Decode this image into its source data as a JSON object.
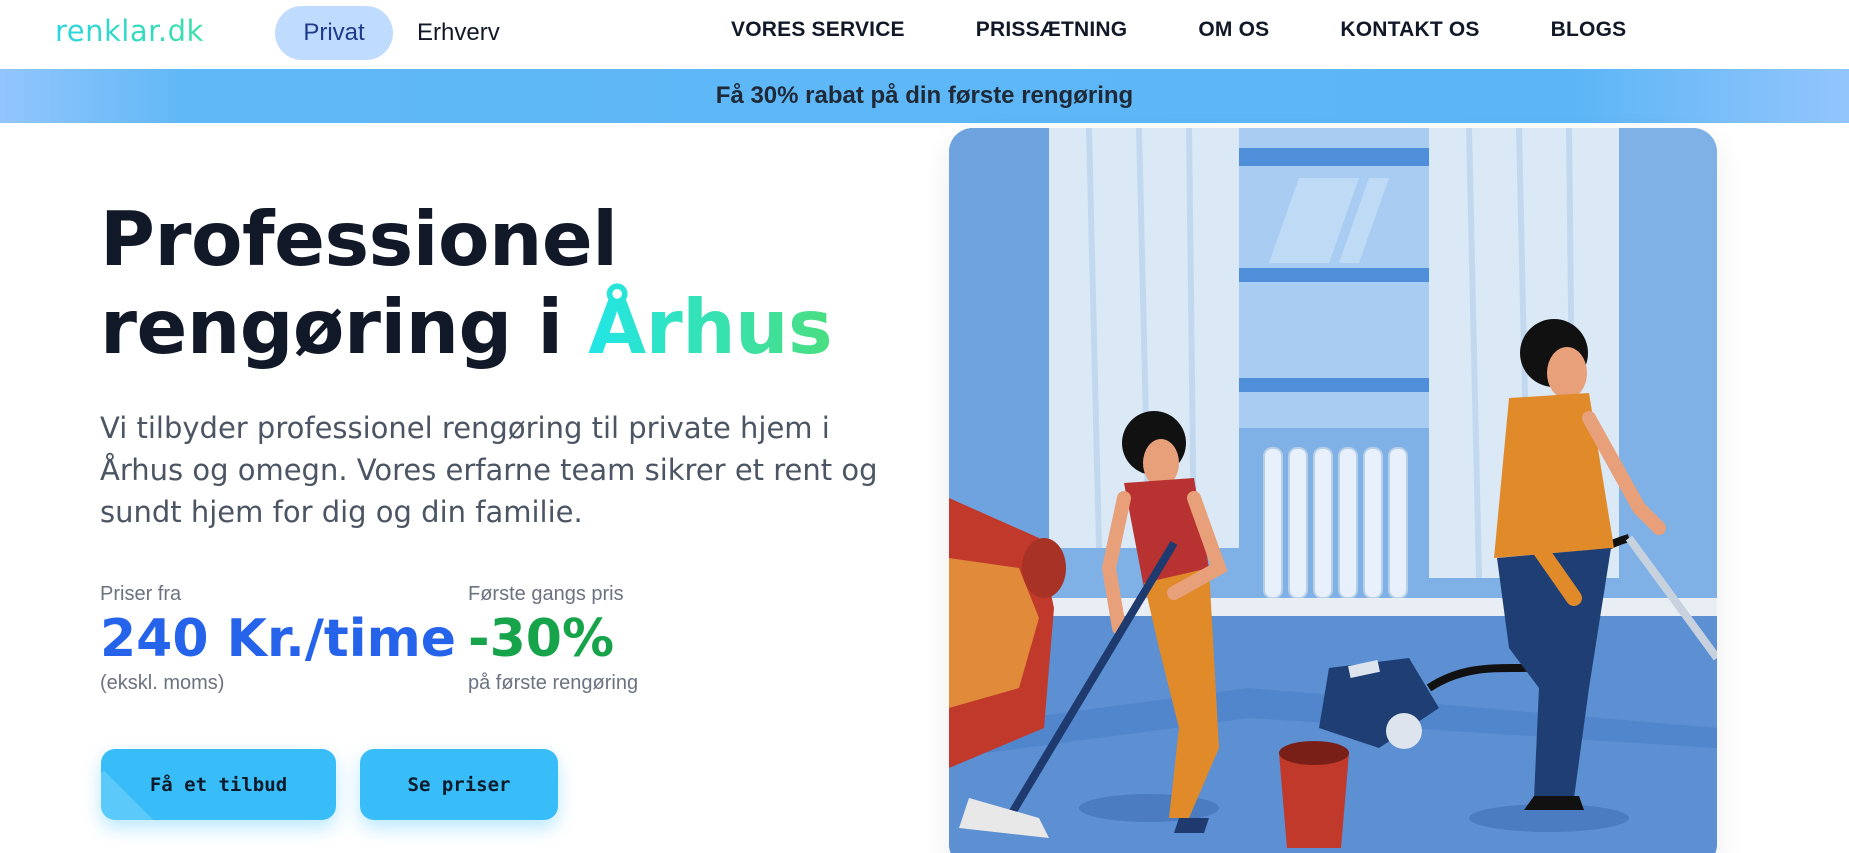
{
  "nav": {
    "logo": "renklar.dk",
    "segments": [
      "Privat",
      "Erhverv"
    ],
    "links": [
      "VORES SERVICE",
      "PRISSÆTNING",
      "OM OS",
      "KONTAKT OS",
      "BLOGS"
    ]
  },
  "promo": {
    "text": "Få 30% rabat på din første rengøring"
  },
  "hero": {
    "title_line1": "Professionel",
    "title_line2": "rengøring i ",
    "title_accent": "Århus",
    "description": "Vi tilbyder professionel rengøring til private hjem i Århus og omegn. Vores erfarne team sikrer et rent og sundt hjem for dig og din familie."
  },
  "stats": [
    {
      "label": "Priser fra",
      "value": "240 Kr./time",
      "sub": "(ekskl. moms)"
    },
    {
      "label": "Første gangs pris",
      "value": "-30%",
      "sub": "på første rengøring"
    }
  ],
  "buttons": {
    "quote": "Få et tilbud",
    "prices": "Se priser"
  },
  "illustration": {
    "subject": "cleaning-illustration"
  },
  "colors": {
    "primary_blue": "#2563eb",
    "green": "#16a34a",
    "button": "#38bdf8",
    "promo_bar": "#60b8f6",
    "accent_cyan": "#22e6e6"
  }
}
